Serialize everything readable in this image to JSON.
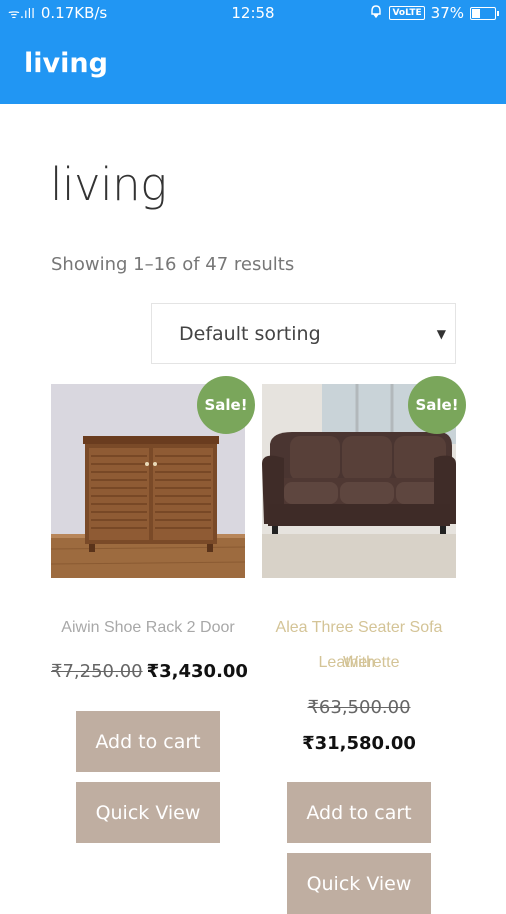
{
  "status_bar": {
    "signal_text": "ᯤ.ıll",
    "network_speed": "0.17KB/s",
    "time": "12:58",
    "volte": "VoLTE",
    "battery": "37%",
    "battery_level": 0.37
  },
  "app_bar": {
    "title": "living"
  },
  "page": {
    "title": "living",
    "result_count": "Showing 1–16 of 47 results"
  },
  "sorting": {
    "selected": "Default sorting",
    "arrow": "▼"
  },
  "products": [
    {
      "sale_badge": "Sale!",
      "name": "Aiwin Shoe Rack 2 Door",
      "name_color": "#a8a8a8",
      "old_price": "₹7,250.00",
      "new_price": "₹3,430.00",
      "add_to_cart": "Add to cart",
      "quick_view": "Quick View"
    },
    {
      "sale_badge": "Sale!",
      "name_line1": "Alea Three Seater Sofa With",
      "name_line2": "Leatherette",
      "name_color": "#d4c497",
      "old_price": "₹63,500.00",
      "new_price": "₹31,580.00",
      "add_to_cart": "Add to cart",
      "quick_view": "Quick View"
    }
  ],
  "colors": {
    "app_bar": "#2196f3",
    "sale_badge": "#7aa65b",
    "button": "#bfaea1"
  }
}
